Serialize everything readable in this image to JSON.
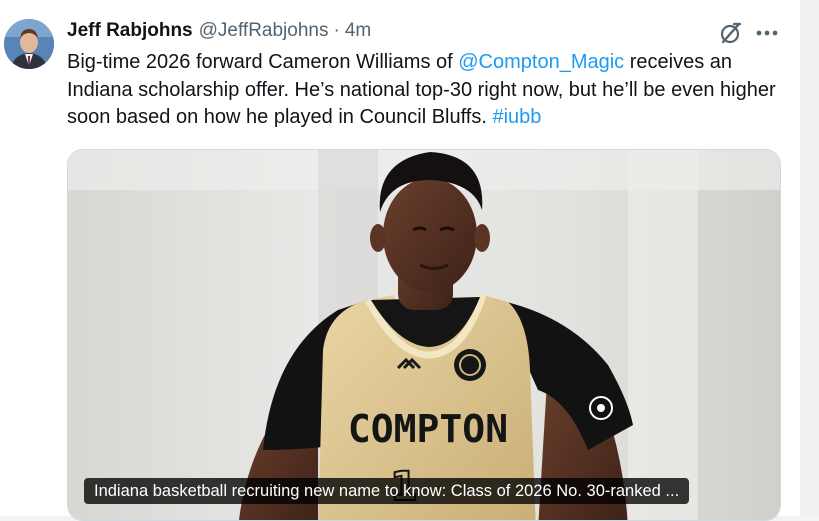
{
  "tweet": {
    "author_name": "Jeff Rabjohns",
    "author_handle": "@JeffRabjohns",
    "separator": "·",
    "time": "4m",
    "text_1": "Big-time 2026 forward Cameron Williams of ",
    "mention": "@Compton_Magic",
    "text_2": " receives an Indiana scholarship offer. He’s national top-30 right now, but he’ll be even higher soon based on how he played in Council Bluffs. ",
    "hashtag": "#iubb",
    "link_color": "#1d9bf0"
  },
  "icons": {
    "grok": "grok-icon",
    "more": "more-icon"
  },
  "media": {
    "jersey_text": "COMPTON",
    "jersey_number": "1",
    "caption": "Indiana basketball recruiting new name to know: Class of 2026 No. 30-ranked ..."
  }
}
